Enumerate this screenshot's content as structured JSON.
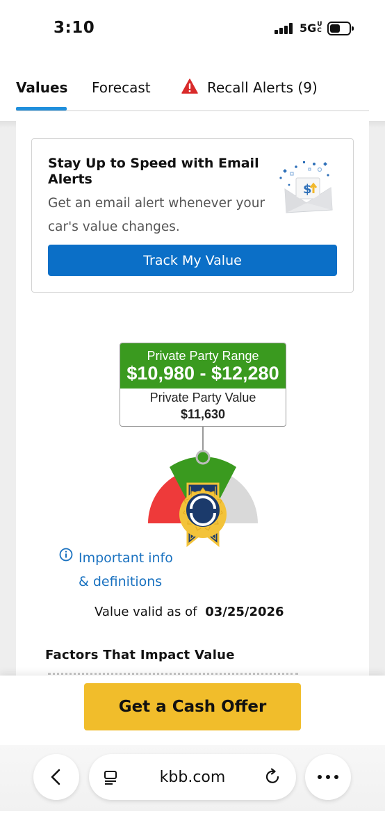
{
  "status_bar": {
    "time": "3:10",
    "network": "5G",
    "network_suffix": "UC",
    "battery": 0.55
  },
  "tabs": [
    {
      "label": "Values",
      "active": true
    },
    {
      "label": "Forecast",
      "active": false
    },
    {
      "label": "Recall Alerts (9)",
      "active": false,
      "icon": "warning-icon"
    }
  ],
  "email_alert": {
    "title": "Stay Up to Speed with Email Alerts",
    "text": "Get an email alert whenever your car's value changes.",
    "button": "Track My Value",
    "icon": "envelope-dollar-icon"
  },
  "valuation": {
    "range_label": "Private Party Range",
    "range_value": "$10,980 - $12,280",
    "value_label": "Private Party Value",
    "value": "$11,630"
  },
  "info_link": {
    "line1": "Important info",
    "line2": "& definitions"
  },
  "valid": {
    "label": "Value valid as of",
    "date": "03/25/2026"
  },
  "factors_title": "Factors That Impact Value",
  "cash_offer_button": "Get a Cash Offer",
  "browser": {
    "url": "kbb.com"
  },
  "colors": {
    "tab_accent": "#1f8fdc",
    "primary_button": "#0b6fc7",
    "range_green": "#3a9a1f",
    "gauge_red": "#ee3a3a",
    "gauge_grey": "#d9d9d9",
    "badge_navy": "#1b3a6b",
    "badge_gold": "#f3c33a",
    "cash_button": "#f1bd2b",
    "link_blue": "#1a72c0"
  }
}
